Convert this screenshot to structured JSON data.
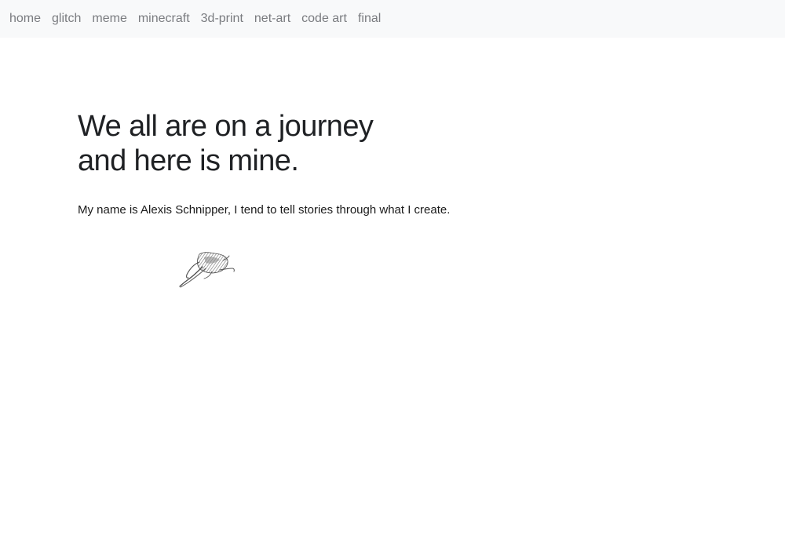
{
  "nav": {
    "items": [
      {
        "label": "home"
      },
      {
        "label": "glitch"
      },
      {
        "label": "meme"
      },
      {
        "label": "minecraft"
      },
      {
        "label": "3d-print"
      },
      {
        "label": "net-art"
      },
      {
        "label": "code art"
      },
      {
        "label": "final"
      }
    ]
  },
  "hero": {
    "title_line1": "We all are on a journey",
    "title_line2": "and here is mine.",
    "intro": "My name is Alexis Schnipper, I tend to tell stories through what I create."
  },
  "illustration": {
    "icon": "pencil-sketch-figure-icon"
  }
}
